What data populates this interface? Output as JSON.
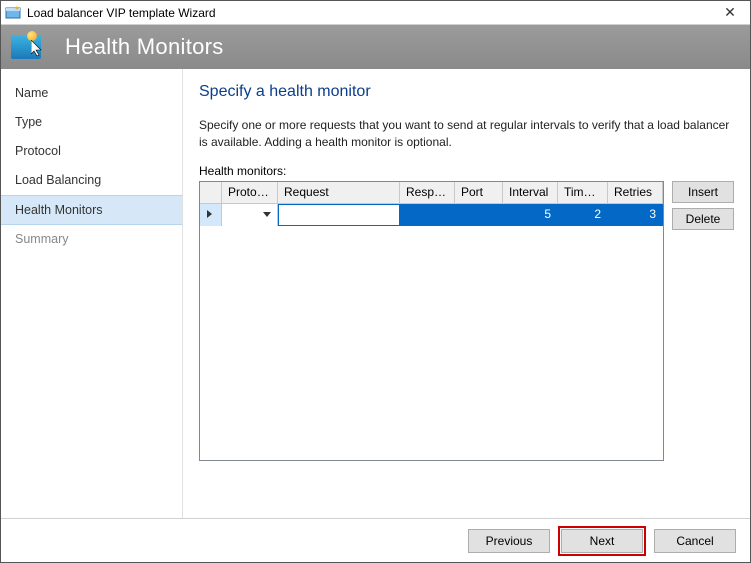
{
  "window": {
    "title": "Load balancer VIP template Wizard",
    "close_glyph": "✕"
  },
  "banner": {
    "title": "Health Monitors"
  },
  "sidebar": {
    "items": [
      {
        "label": "Name"
      },
      {
        "label": "Type"
      },
      {
        "label": "Protocol"
      },
      {
        "label": "Load Balancing"
      },
      {
        "label": "Health Monitors",
        "selected": true
      },
      {
        "label": "Summary",
        "disabled": true
      }
    ]
  },
  "main": {
    "heading": "Specify a health monitor",
    "description": "Specify one or more requests that you want to send at regular intervals to verify that a load balancer is available. Adding a health monitor is optional.",
    "grid_label": "Health monitors:",
    "columns": {
      "protocol": "Protocol",
      "request": "Request",
      "response": "Respo...",
      "port": "Port",
      "interval": "Interval",
      "timeout": "Time-...",
      "retries": "Retries"
    },
    "row": {
      "protocol": "",
      "request": "",
      "response": "",
      "port": "",
      "interval": "5",
      "timeout": "2",
      "retries": "3"
    },
    "buttons": {
      "insert": "Insert",
      "delete": "Delete"
    }
  },
  "footer": {
    "previous": "Previous",
    "next": "Next",
    "cancel": "Cancel"
  }
}
